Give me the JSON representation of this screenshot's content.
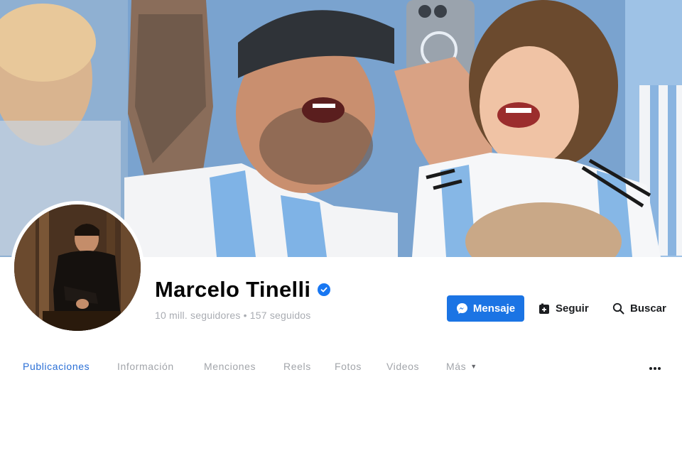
{
  "profile": {
    "name": "Marcelo Tinelli",
    "stats": "10 mill. seguidores • 157 seguidos",
    "verified_icon": "verified-badge-icon"
  },
  "actions": {
    "message_label": "Mensaje",
    "follow_label": "Seguir",
    "search_label": "Buscar"
  },
  "tabs": [
    {
      "label": "Publicaciones",
      "active": true
    },
    {
      "label": "Información",
      "active": false
    },
    {
      "label": "Menciones",
      "active": false
    },
    {
      "label": "Reels",
      "active": false
    },
    {
      "label": "Fotos",
      "active": false
    },
    {
      "label": "Videos",
      "active": false
    },
    {
      "label": "Más",
      "active": false
    }
  ],
  "colors": {
    "accent": "#1b74e4",
    "active_tab": "#2a6fd6",
    "muted_text": "#a2a5aa"
  }
}
